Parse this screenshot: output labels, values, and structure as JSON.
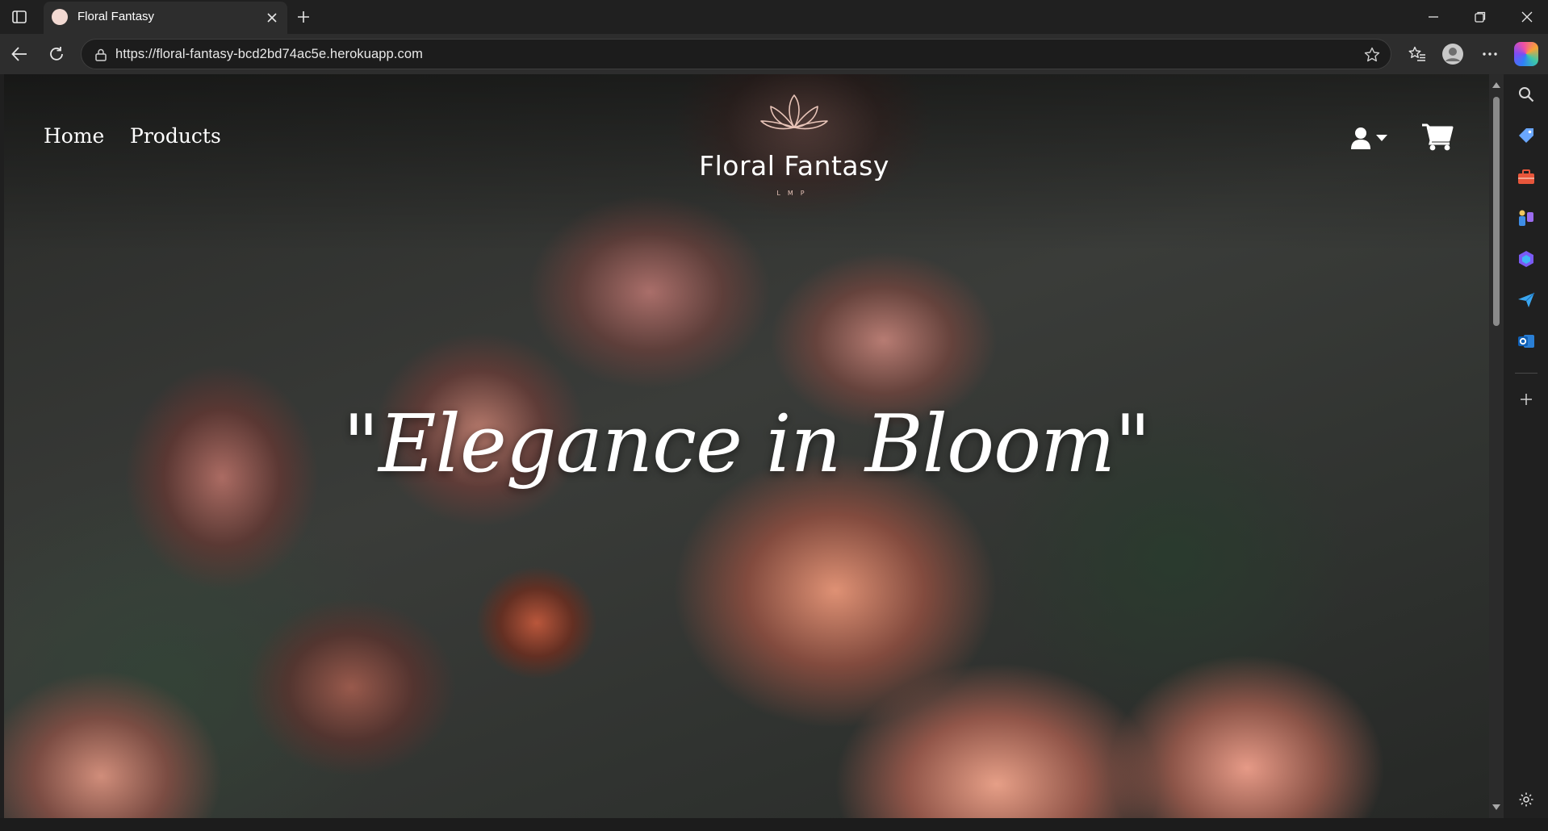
{
  "browser": {
    "tab": {
      "title": "Floral Fantasy",
      "favicon": "flower-favicon"
    },
    "address_bar": {
      "url": "https://floral-fantasy-bcd2bd74ac5e.herokuapp.com"
    },
    "icons": [
      "sidebar-toggle-icon",
      "close-icon",
      "plus-icon",
      "minimize-icon",
      "restore-icon",
      "close-icon",
      "back-arrow-icon",
      "refresh-icon",
      "lock-icon",
      "star-icon",
      "favorites-icon",
      "profile-icon",
      "more-icon",
      "copilot-icon"
    ]
  },
  "site": {
    "nav": {
      "home": "Home",
      "products": "Products"
    },
    "logo": {
      "name": "Floral Fantasy",
      "tagline": "LMP"
    },
    "hero": {
      "quote": "\"Elegance in Bloom\""
    },
    "header_icons": [
      "user-icon",
      "caret-down-icon",
      "cart-icon"
    ]
  },
  "edge_sidebar": {
    "items": [
      "search-icon",
      "shopping-tag-icon",
      "tools-icon",
      "games-icon",
      "microsoft365-icon",
      "send-icon",
      "outlook-icon",
      "add-icon",
      "settings-icon"
    ]
  },
  "colors": {
    "chrome_bg": "#202020",
    "toolbar_bg": "#2d2d2d",
    "text_white": "#ffffff",
    "rose_accent": "#e6c3b8"
  }
}
